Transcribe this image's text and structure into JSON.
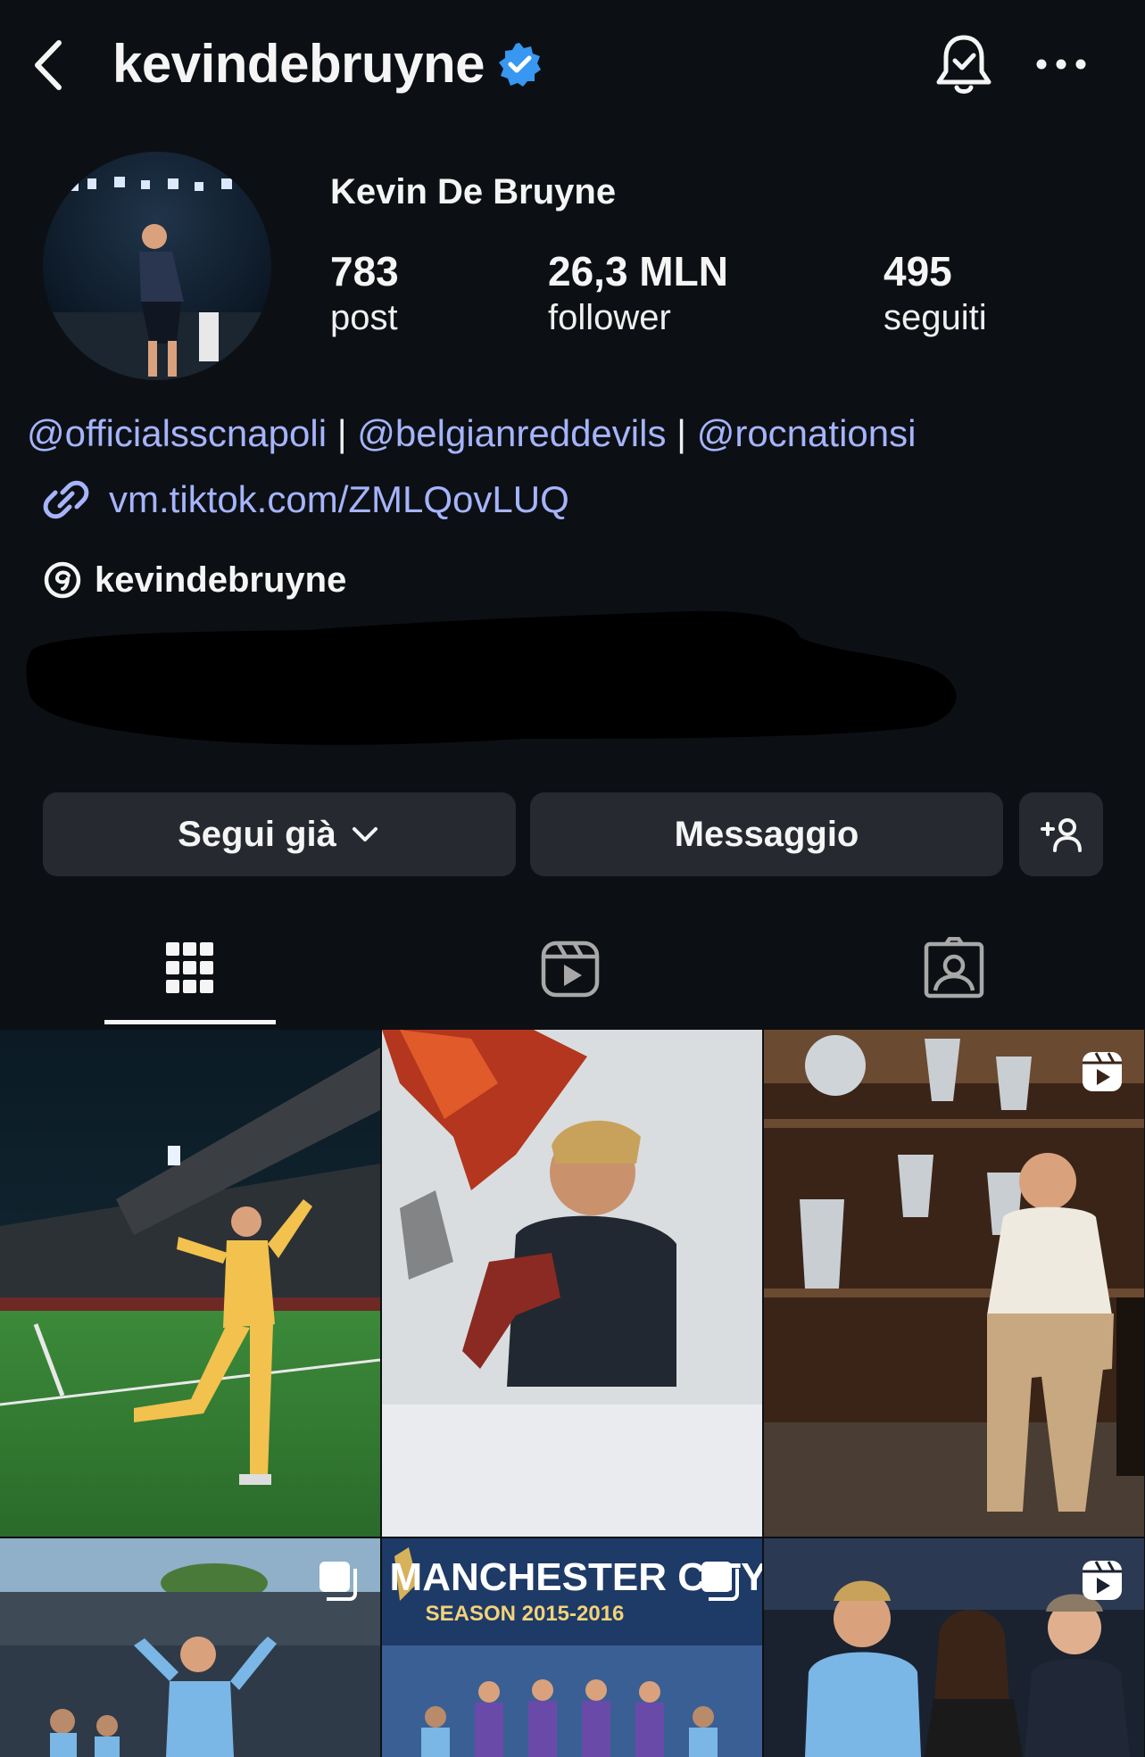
{
  "header": {
    "username": "kevindebruyne",
    "verified": true,
    "icons": [
      "back-arrow-icon",
      "verified-badge-icon",
      "notification-bell-icon",
      "more-options-icon"
    ]
  },
  "profile": {
    "full_name": "Kevin De Bruyne",
    "stats": [
      {
        "value": "783",
        "label": "post"
      },
      {
        "value": "26,3 MLN",
        "label": "follower"
      },
      {
        "value": "495",
        "label": "seguiti"
      }
    ]
  },
  "bio": {
    "mentions": [
      "@officialsscnapoli",
      "@belgianreddevils",
      "@rocnationsi"
    ],
    "separator": " | ",
    "link": "vm.tiktok.com/ZMLQovLUQ",
    "threads_handle": "kevindebruyne"
  },
  "actions": {
    "follow_label": "Segui già",
    "message_label": "Messaggio"
  },
  "tabs": [
    "posts-grid",
    "reels",
    "tagged"
  ],
  "colors": {
    "background": "#0c1014",
    "button": "#262a30",
    "link": "#a5b4fc",
    "verified": "#3897f0"
  },
  "grid": [
    {
      "type": "photo",
      "badge": "none"
    },
    {
      "type": "photo",
      "badge": "none"
    },
    {
      "type": "reel",
      "badge": "reel-icon"
    },
    {
      "type": "carousel",
      "badge": "carousel-icon"
    },
    {
      "type": "carousel",
      "badge": "carousel-icon",
      "overlay_title": "MANCHESTER CITY",
      "overlay_subtitle": "SEASON 2015-2016"
    },
    {
      "type": "reel",
      "badge": "reel-icon"
    }
  ]
}
